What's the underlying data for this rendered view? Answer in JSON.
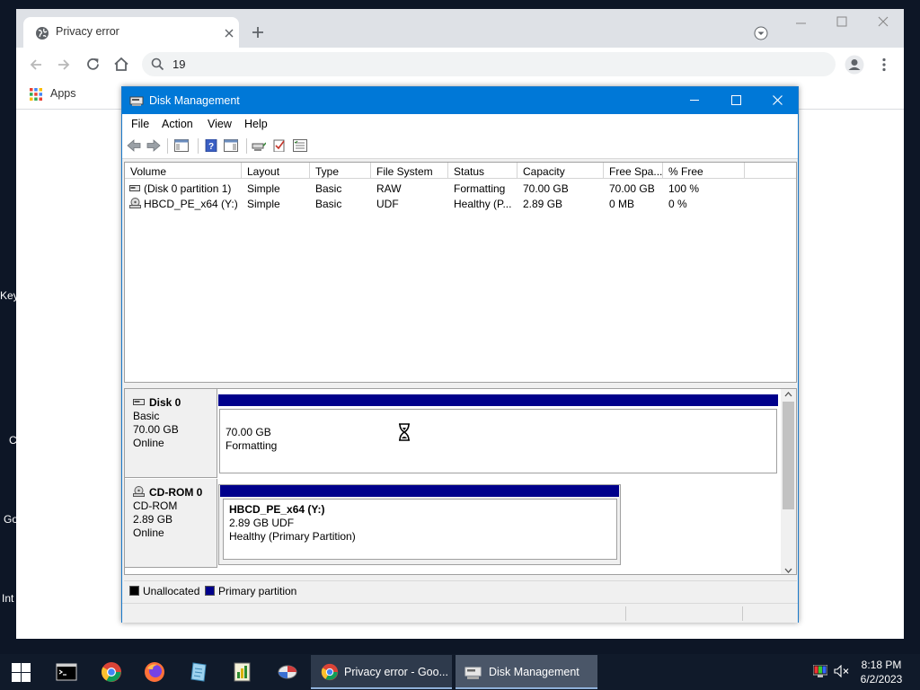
{
  "desktop": {
    "side_texts": [
      "Key",
      "C",
      "Go",
      "Int"
    ]
  },
  "browser": {
    "tab_title": "Privacy error",
    "address_text": "19",
    "bookmarks": {
      "apps_label": "Apps"
    }
  },
  "disk_management": {
    "title": "Disk Management",
    "menu": [
      "File",
      "Action",
      "View",
      "Help"
    ],
    "columns": [
      "Volume",
      "Layout",
      "Type",
      "File System",
      "Status",
      "Capacity",
      "Free Spa...",
      "% Free"
    ],
    "volumes": [
      {
        "volume": "(Disk 0 partition 1)",
        "layout": "Simple",
        "type": "Basic",
        "fs": "RAW",
        "status": "Formatting",
        "capacity": "70.00 GB",
        "free": "70.00 GB",
        "pct_free": "100 %"
      },
      {
        "volume": "HBCD_PE_x64 (Y:)",
        "layout": "Simple",
        "type": "Basic",
        "fs": "UDF",
        "status": "Healthy (P...",
        "capacity": "2.89 GB",
        "free": "0 MB",
        "pct_free": "0 %"
      }
    ],
    "disks": [
      {
        "name": "Disk 0",
        "kind": "Basic",
        "size": "70.00 GB",
        "state": "Online",
        "partition": {
          "title": "",
          "size_line": "70.00 GB",
          "status_line": "Formatting"
        }
      },
      {
        "name": "CD-ROM 0",
        "kind": "CD-ROM",
        "size": "2.89 GB",
        "state": "Online",
        "partition": {
          "title": "HBCD_PE_x64  (Y:)",
          "size_line": "2.89 GB UDF",
          "status_line": "Healthy (Primary Partition)"
        }
      }
    ],
    "legend": [
      {
        "label": "Unallocated",
        "color": "#000000"
      },
      {
        "label": "Primary partition",
        "color": "#00008b"
      }
    ],
    "colors": {
      "title_bar": "#0078d7",
      "partition_bar": "#00008b"
    }
  },
  "taskbar": {
    "chrome_window_label": "Privacy error - Goo...",
    "diskmgmt_window_label": "Disk Management",
    "clock_time": "8:18 PM",
    "clock_date": "6/2/2023",
    "colors": {
      "background": "#101a2a"
    }
  }
}
